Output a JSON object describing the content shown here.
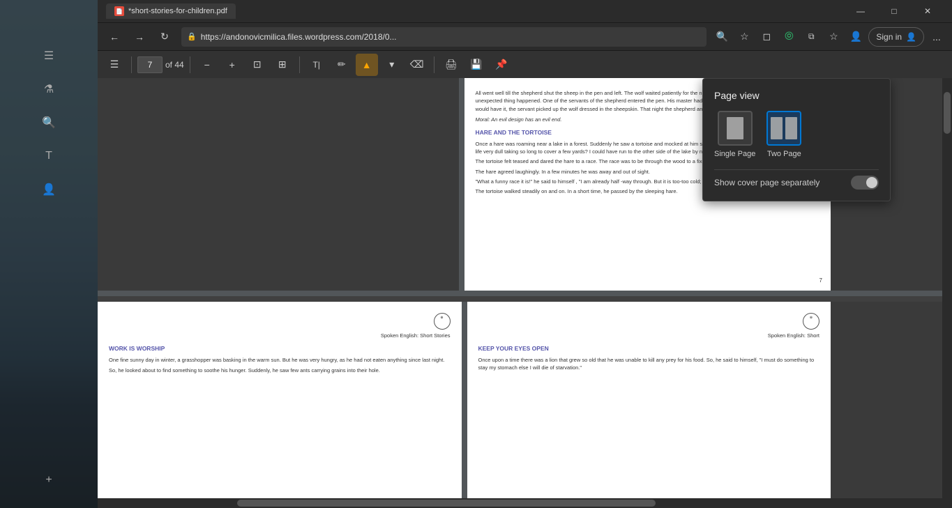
{
  "browser": {
    "tab": {
      "title": "*short-stories-for-children.pdf",
      "icon": "📄"
    },
    "window_controls": {
      "minimize": "—",
      "maximize": "□",
      "close": "✕"
    }
  },
  "nav": {
    "back": "←",
    "forward": "→",
    "refresh": "↻",
    "lock_icon": "🔒",
    "address": "https://andonovicmilica.files.wordpress.com/2018/0...",
    "search_icon": "🔍",
    "favorites_icon": "☆",
    "browser_icon": "◻",
    "collections_icon": "📚",
    "profile_icon": "👤",
    "sign_in": "Sign in",
    "more": "..."
  },
  "pdf_toolbar": {
    "sidebar_toggle": "☰",
    "page_current": "7",
    "page_total": "of 44",
    "zoom_out": "−",
    "zoom_in": "+",
    "fit_page": "⊡",
    "fit_width": "⊞",
    "text_select": "T",
    "highlight": "✏",
    "dropdown": "▾",
    "ink_btn": "🖊",
    "erase": "⌫",
    "print": "🖨",
    "save": "💾",
    "pin": "📌"
  },
  "page_view_popup": {
    "title": "Page view",
    "single_page_label": "Single Page",
    "two_page_label": "Two Page",
    "cover_label": "Show cover page separately",
    "toggle_state": "off"
  },
  "pdf_content": {
    "page7": {
      "text1": "All went well till the shepherd shut the sheep in the pen and left. The wolf waited patiently for the night to advance and grow darker. But then an unexpected thing happened. One of the servants of the shepherd entered the pen. His master had sent him to bring a fat sheep for supper. As luck would have it, the servant picked up the wolf dressed in the sheepskin. That night the shepherd and his guests had the wolf for supper.",
      "italic": "Moral: An evil design has an evil end.",
      "title1": "HARE AND THE TORTOISE",
      "text2": "Once a hare was roaming near a lake in a forest. Suddenly he saw a tortoise and mocked at him saying - \"Hurry up, you slow coach! Don't you find life very dull taking so long to cover a few yards? I could have run to the other side of the lake by now.\"",
      "text3": "The tortoise felt teased and dared the hare to a race. The race was to be through the wood to a fixed goal.",
      "text4": "The hare agreed laughingly. In a few minutes he was away and out of sight.",
      "text5": "\"What a funny race it is!\" he said to himself , \"I am already half -way through. But it is too-too cold; why not have a nap in the warm sunshine?\"",
      "text6": "The tortoise walked steadily on and on. In a short time, he passed by the sleeping hare.",
      "page_num": "7"
    },
    "page8": {
      "subtitle": "Spoken English: Short Stories",
      "title": "WORK IS WORSHIP",
      "text": "One fine sunny day in winter, a grasshopper was basking in the warm sun. But he was very hungry, as he had not eaten anything since last night.",
      "text2": "So, he looked about to find something to soothe his hunger. Suddenly, he saw few ants carrying grains into their hole."
    },
    "page9": {
      "subtitle": "Spoken English: Short",
      "title": "KEEP YOUR EYES OPEN",
      "text": "Once upon a time there was a lion that grew so old that he was unable to kill any prey for his food. So, he said to himself, \"I must do something to stay my stomach else I will die of starvation.\""
    }
  }
}
